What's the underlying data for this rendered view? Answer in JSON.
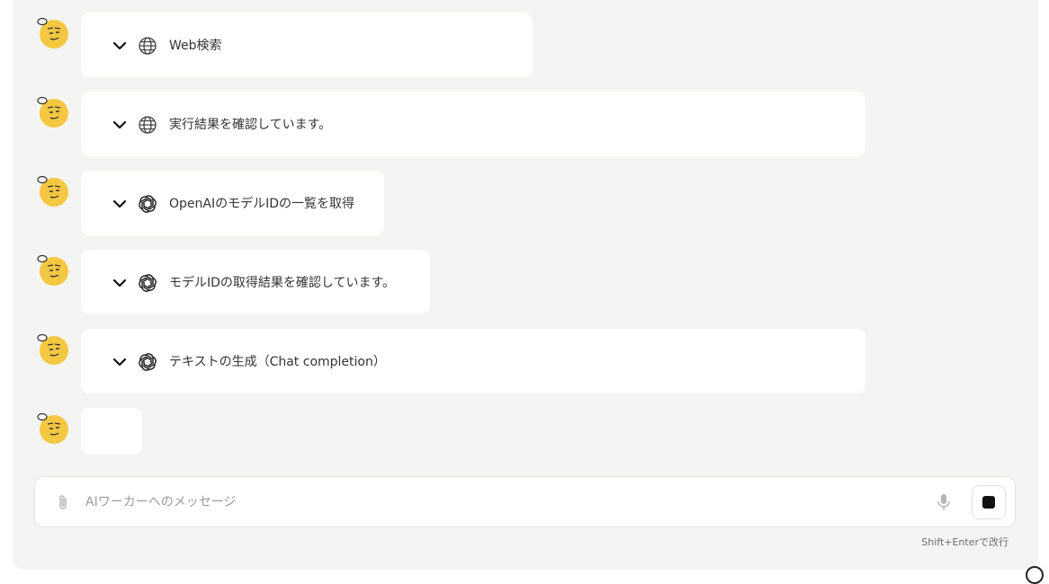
{
  "messages": [
    {
      "icon": "globe-icon",
      "label": "Web検索"
    },
    {
      "icon": "globe-icon",
      "label": "実行結果を確認しています。"
    },
    {
      "icon": "openai-icon",
      "label": "OpenAIのモデルIDの一覧を取得"
    },
    {
      "icon": "openai-icon",
      "label": "モデルIDの取得結果を確認しています。"
    },
    {
      "icon": "openai-icon",
      "label": "テキストの生成（Chat completion）"
    },
    {
      "icon": "",
      "label": ""
    }
  ],
  "composer": {
    "placeholder": "AIワーカーへのメッセージ",
    "hint": "Shift+Enterで改行"
  },
  "colors": {
    "panel_bg": "#f4f4f3",
    "card_bg": "#ffffff",
    "avatar_yellow": "#f5c842"
  }
}
